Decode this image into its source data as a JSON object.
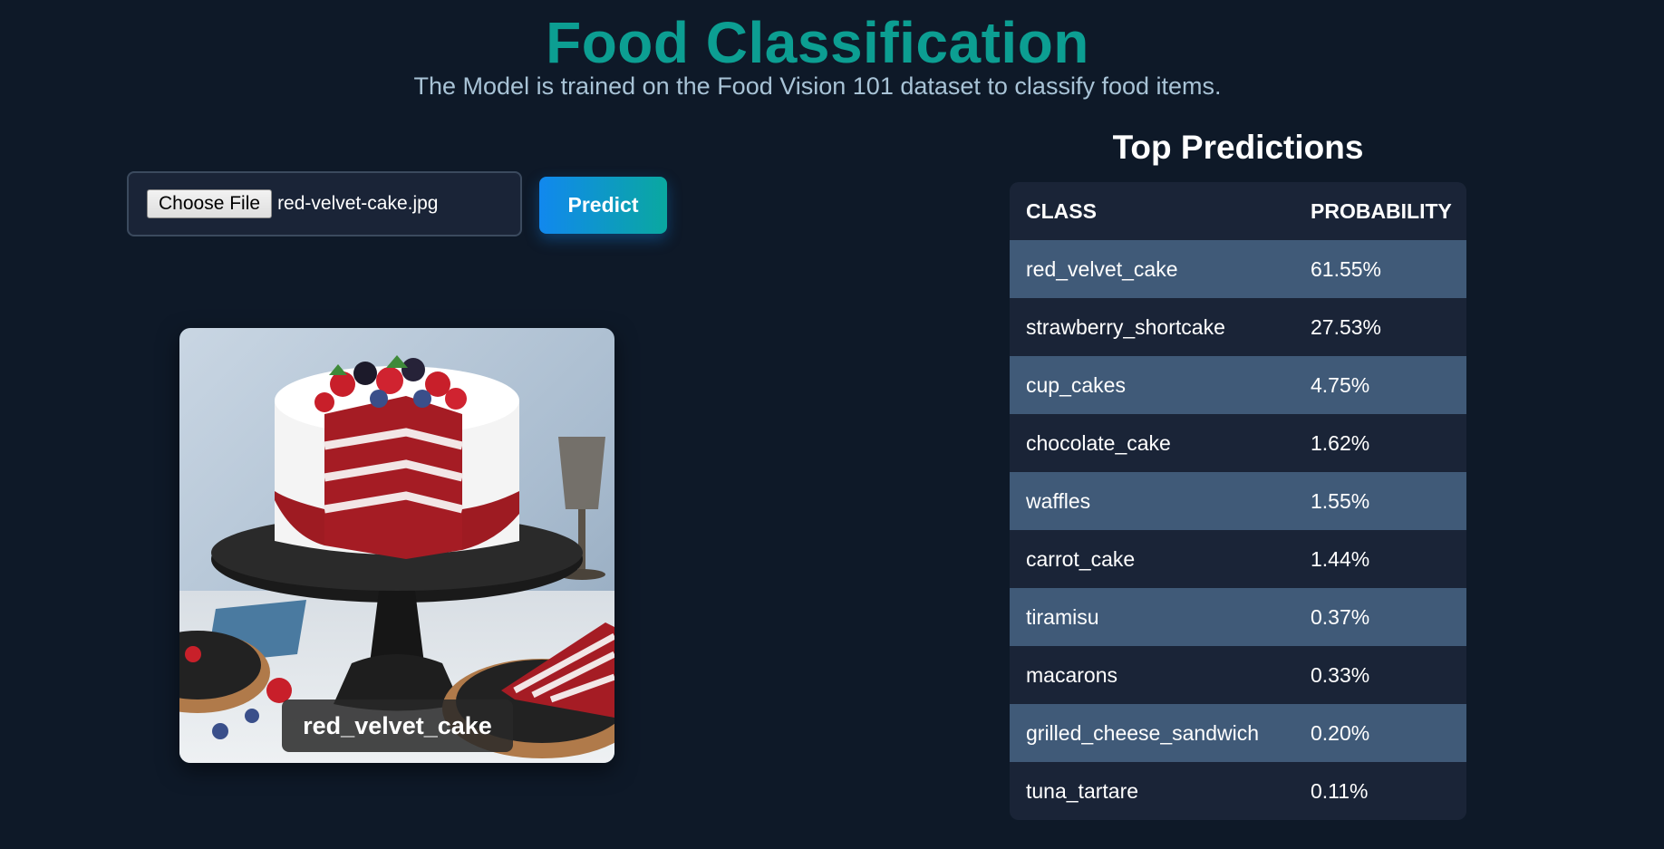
{
  "header": {
    "title": "Food Classification",
    "subtitle": "The Model is trained on the Food Vision 101 dataset to classify food items."
  },
  "upload": {
    "choose_label": "Choose File",
    "file_name": "red-velvet-cake.jpg",
    "predict_label": "Predict"
  },
  "preview": {
    "label": "red_velvet_cake"
  },
  "predictions": {
    "heading": "Top Predictions",
    "columns": [
      "CLASS",
      "PROBABILITY"
    ],
    "rows": [
      {
        "class": "red_velvet_cake",
        "probability": "61.55%"
      },
      {
        "class": "strawberry_shortcake",
        "probability": "27.53%"
      },
      {
        "class": "cup_cakes",
        "probability": "4.75%"
      },
      {
        "class": "chocolate_cake",
        "probability": "1.62%"
      },
      {
        "class": "waffles",
        "probability": "1.55%"
      },
      {
        "class": "carrot_cake",
        "probability": "1.44%"
      },
      {
        "class": "tiramisu",
        "probability": "0.37%"
      },
      {
        "class": "macarons",
        "probability": "0.33%"
      },
      {
        "class": "grilled_cheese_sandwich",
        "probability": "0.20%"
      },
      {
        "class": "tuna_tartare",
        "probability": "0.11%"
      }
    ]
  },
  "colors": {
    "background": "#0e1928",
    "title": "#0c9e92",
    "row_highlight": "#405a78",
    "row_dark": "#1a2437",
    "button_gradient_start": "#1188ee",
    "button_gradient_end": "#0aa8a0"
  }
}
